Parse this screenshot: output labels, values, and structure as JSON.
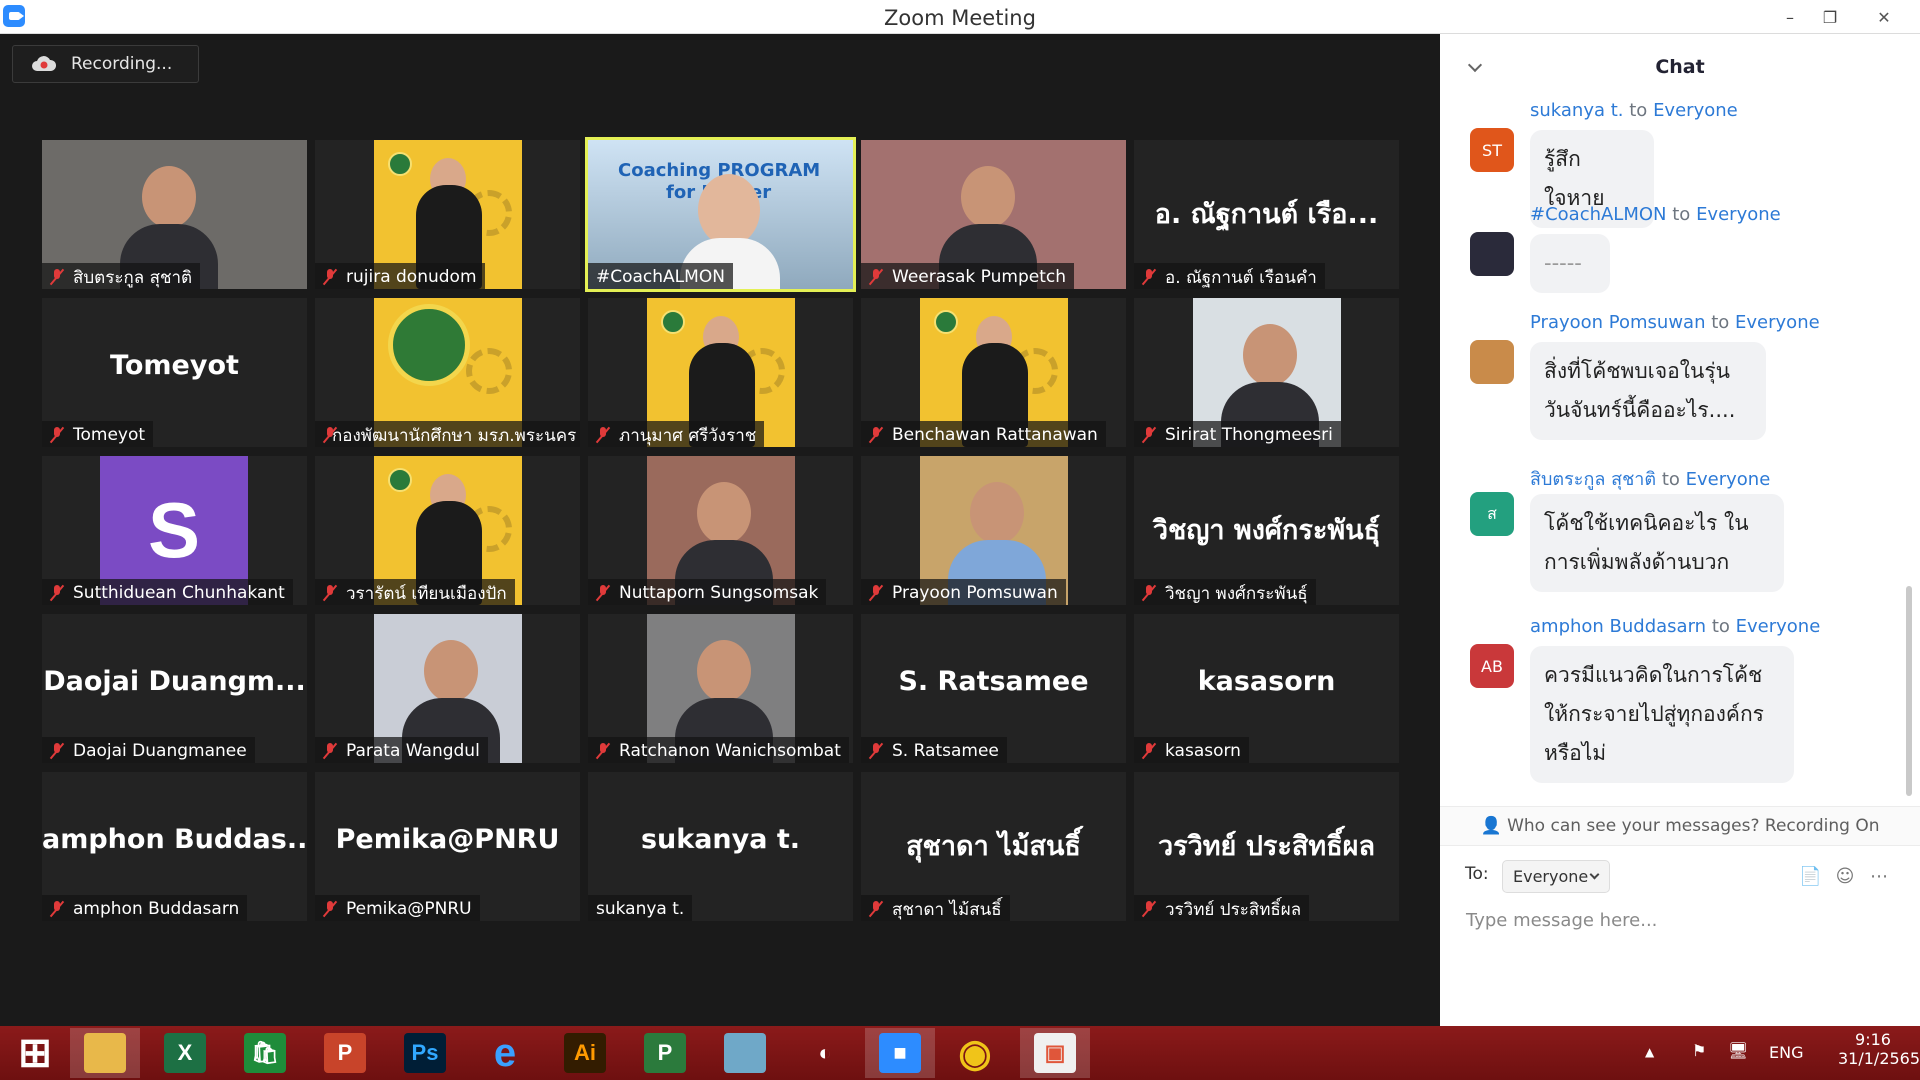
{
  "window": {
    "title": "Zoom Meeting"
  },
  "recording": {
    "label": "Recording..."
  },
  "participants": [
    {
      "name": "สิบตระกูล สุชาติ",
      "display": ""
    },
    {
      "name": "rujira donudom",
      "display": ""
    },
    {
      "name": "#CoachALMON",
      "display": ""
    },
    {
      "name": "Weerasak Pumpetch",
      "display": ""
    },
    {
      "name": "อ. ณัฐกานต์ เรือนคำ",
      "display": "อ. ณัฐกานต์ เรือ..."
    },
    {
      "name": "Tomeyot",
      "display": "Tomeyot"
    },
    {
      "name": "กองพัฒนานักศึกษา มรภ.พระนคร",
      "display": ""
    },
    {
      "name": "ภานุมาศ ศรีวังราช",
      "display": ""
    },
    {
      "name": "Benchawan Rattanawan",
      "display": ""
    },
    {
      "name": "Sirirat Thongmeesri",
      "display": ""
    },
    {
      "name": "Sutthiduean Chunhakant",
      "display": "S"
    },
    {
      "name": "วรารัตน์ เทียนเมืองปัก",
      "display": ""
    },
    {
      "name": "Nuttaporn Sungsomsak",
      "display": ""
    },
    {
      "name": "Prayoon Pomsuwan",
      "display": ""
    },
    {
      "name": "วิชญา พงศ์กระพันธุ์",
      "display": "วิชญา พงศ์กระพันธุ์"
    },
    {
      "name": "Daojai Duangmanee",
      "display": "Daojai Duangm..."
    },
    {
      "name": "Parata Wangdul",
      "display": ""
    },
    {
      "name": "Ratchanon Wanichsombat",
      "display": ""
    },
    {
      "name": "S. Ratsamee",
      "display": "S. Ratsamee"
    },
    {
      "name": "kasasorn",
      "display": "kasasorn"
    },
    {
      "name": "amphon Buddasarn",
      "display": "amphon Buddas..."
    },
    {
      "name": "Pemika@PNRU",
      "display": "Pemika@PNRU"
    },
    {
      "name": "sukanya t.",
      "display": "sukanya t."
    },
    {
      "name": "สุชาดา ไม้สนธิ์",
      "display": "สุชาดา ไม้สนธิ์"
    },
    {
      "name": "วรวิทย์ ประสิทธิ์ผล",
      "display": "วรวิทย์ ประสิทธิ์ผล"
    }
  ],
  "active_tile_text": {
    "line1": "Coaching PROGRAM",
    "line2": "for Leader"
  },
  "chat": {
    "title": "Chat",
    "messages": [
      {
        "sender": "sukanya t.",
        "to": "to",
        "target": "Everyone",
        "initials": "ST",
        "color": "#e0561b",
        "text": "รู้สึกใจหาย"
      },
      {
        "sender": "#CoachALMON",
        "to": "to",
        "target": "Everyone",
        "initials": "",
        "color": "#2a2a3a",
        "text": "-----"
      },
      {
        "sender": "Prayoon Pomsuwan",
        "to": "to",
        "target": "Everyone",
        "initials": "",
        "color": "#c98b4a",
        "text": "สิ่งที่โค้ชพบเจอในรุ่นวันจันทร์นี้คืออะไร...."
      },
      {
        "sender": "สิบตระกูล สุชาติ",
        "to": "to",
        "target": "Everyone",
        "initials": "ส",
        "color": "#23a07f",
        "text": "โค้ชใช้เทคนิคอะไร ในการเพิ่มพลังด้านบวก"
      },
      {
        "sender": "amphon Buddasarn",
        "to": "to",
        "target": "Everyone",
        "initials": "AB",
        "color": "#c9383a",
        "text": "ควรมีแนวคิดในการโค้ชให้กระจายไปสู่ทุกองค์กรหรือไม่"
      }
    ],
    "visibility": "Who can see your messages? Recording On",
    "to_label": "To:",
    "recipient": "Everyone",
    "placeholder": "Type message here..."
  },
  "taskbar": {
    "apps": [
      "windows-start",
      "file-explorer",
      "excel",
      "store",
      "powerpoint",
      "photoshop",
      "internet-explorer",
      "illustrator",
      "project",
      "notepad",
      "photoscape",
      "zoom",
      "chrome",
      "photos"
    ],
    "language": "ENG",
    "time": "9:16",
    "date": "31/1/2565"
  },
  "colors": {
    "accent": "#2d8cff",
    "active_speaker": "#e4f055",
    "taskbar": "#7a1414",
    "chat_link": "#2d7ad6"
  }
}
